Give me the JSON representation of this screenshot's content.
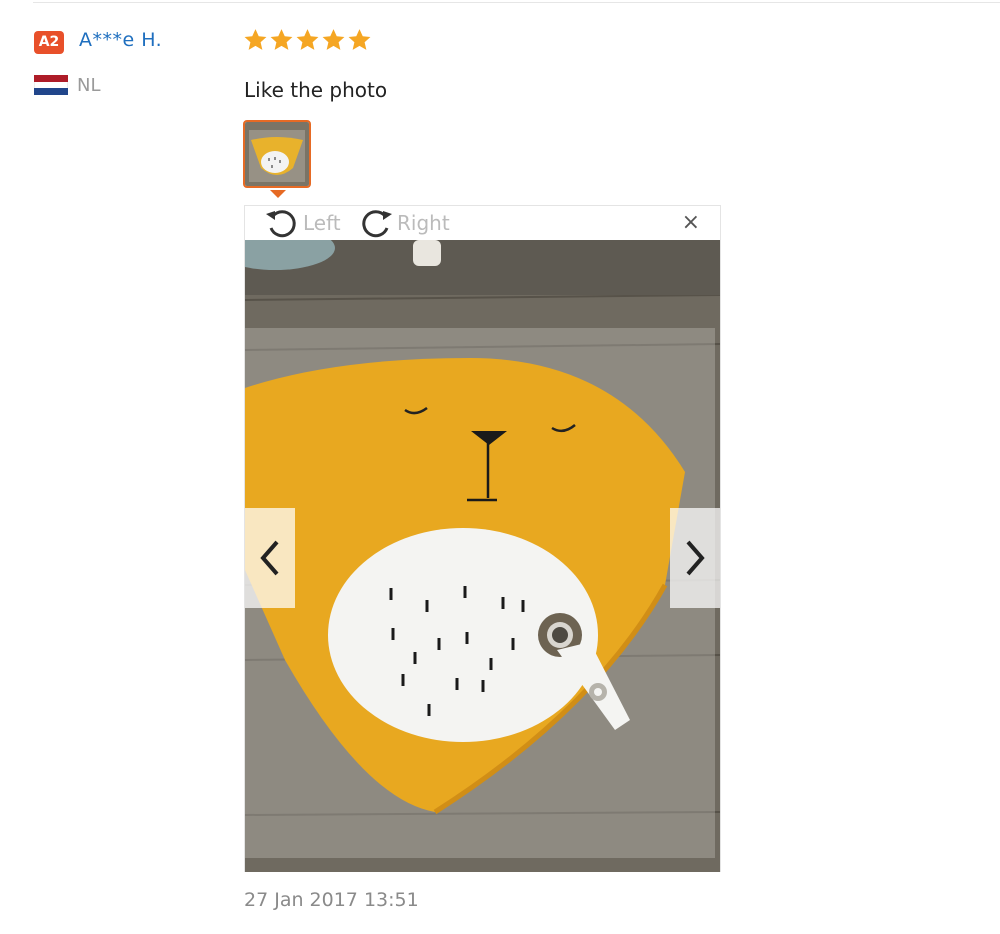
{
  "buyer": {
    "level_badge": "A2",
    "name": "A***e H.",
    "country": "NL",
    "flag_colors": [
      "#ae1c28",
      "#ffffff",
      "#21468b"
    ]
  },
  "review": {
    "rating": 5,
    "text": "Like the photo",
    "date": "27 Jan 2017 13:51"
  },
  "viewer": {
    "rotate_left_label": "Left",
    "rotate_right_label": "Right",
    "close_label": "×",
    "icons": {
      "rotate_left": "rotate-left-icon",
      "rotate_right": "rotate-right-icon",
      "prev": "chevron-left-icon",
      "next": "chevron-right-icon"
    }
  },
  "colors": {
    "accent": "#e66a24",
    "star": "#f5a623",
    "link": "#1f6fbf",
    "badge": "#e8502a"
  }
}
